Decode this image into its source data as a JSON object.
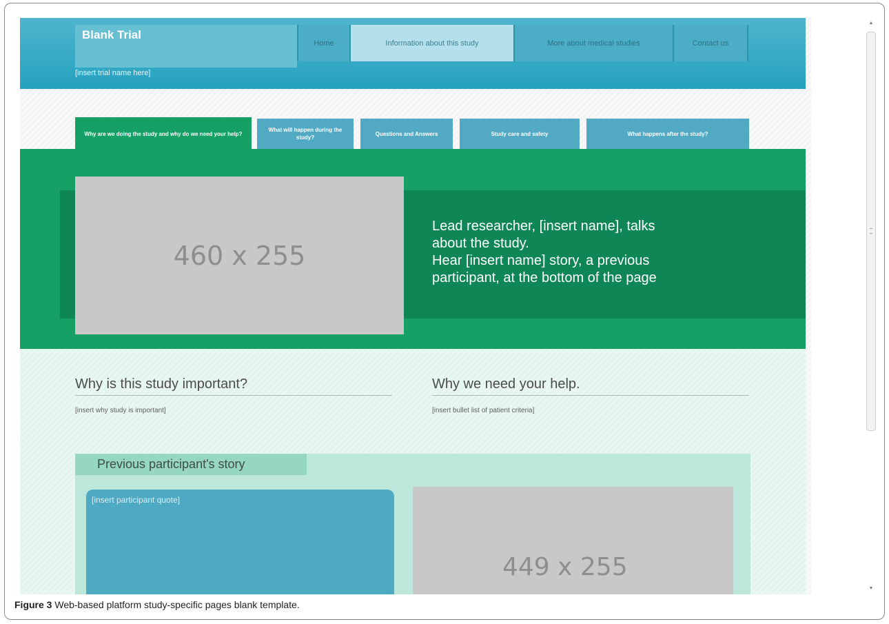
{
  "header": {
    "brand_title": "Blank Trial",
    "trial_name_placeholder": "[insert trial name here]",
    "nav": [
      "Home",
      "Information about this study",
      "More about medical studies",
      "Contact us"
    ]
  },
  "subtabs": [
    "Why are we doing the study and why do we need your help?",
    "What will happen during the study?",
    "Questions and Answers",
    "Study care and safety",
    "What happens after the study?"
  ],
  "hero": {
    "image_placeholder": "460 x 255",
    "lines": [
      "Lead researcher, [insert name], talks",
      "about the study.",
      "Hear [insert name] story, a previous",
      "participant, at the bottom of the page"
    ]
  },
  "sections": {
    "left_title": "Why is this study important?",
    "left_body": "[insert why study is important]",
    "right_title": "Why we need your help.",
    "right_body": "[insert bullet list of patient criteria]"
  },
  "story": {
    "title": "Previous participant's story",
    "quote_placeholder": "[insert participant quote]",
    "image_placeholder": "449 x 255"
  },
  "caption": {
    "label": "Figure 3",
    "text": "Web-based platform study-specific pages blank template."
  },
  "scrollbar": {
    "up_icon": "▲",
    "down_icon": "▼"
  }
}
